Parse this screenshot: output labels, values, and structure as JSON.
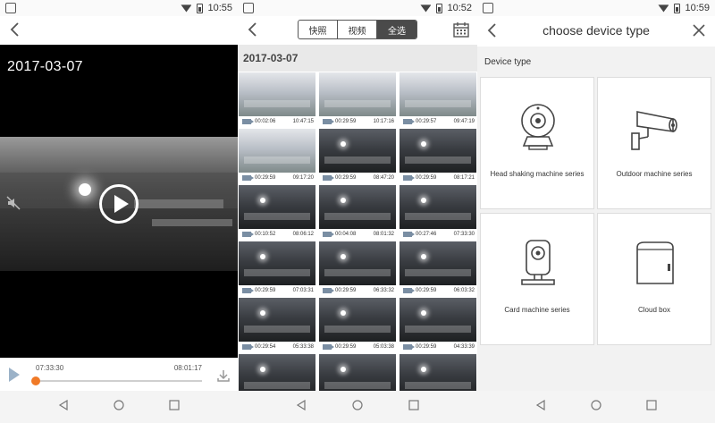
{
  "status_time_1": "10:55",
  "status_time_2": "10:52",
  "status_time_3": "10:59",
  "player": {
    "date_title": "2017-03-07",
    "time_start": "07:33:30",
    "time_end": "08:01:17",
    "progress_fraction": 0.0
  },
  "gallery": {
    "tabs": [
      "快照",
      "视频",
      "全选"
    ],
    "date_label": "2017-03-07",
    "items": [
      {
        "dur": "00:02:06",
        "ts": "10:47:15",
        "tone": "light"
      },
      {
        "dur": "00:29:59",
        "ts": "10:17:16",
        "tone": "light"
      },
      {
        "dur": "00:29:57",
        "ts": "09:47:19",
        "tone": "light"
      },
      {
        "dur": "00:29:59",
        "ts": "09:17:20",
        "tone": "light"
      },
      {
        "dur": "00:29:59",
        "ts": "08:47:20",
        "tone": "dark"
      },
      {
        "dur": "00:29:59",
        "ts": "08:17:21",
        "tone": "dark"
      },
      {
        "dur": "00:10:52",
        "ts": "08:06:12",
        "tone": "dark"
      },
      {
        "dur": "00:04:08",
        "ts": "08:01:32",
        "tone": "dark"
      },
      {
        "dur": "00:27:46",
        "ts": "07:33:30",
        "tone": "dark"
      },
      {
        "dur": "00:29:59",
        "ts": "07:03:31",
        "tone": "dark"
      },
      {
        "dur": "00:29:59",
        "ts": "06:33:32",
        "tone": "dark"
      },
      {
        "dur": "00:29:59",
        "ts": "06:03:32",
        "tone": "dark"
      },
      {
        "dur": "00:29:54",
        "ts": "05:33:38",
        "tone": "dark"
      },
      {
        "dur": "00:29:59",
        "ts": "05:03:38",
        "tone": "dark"
      },
      {
        "dur": "00:29:59",
        "ts": "04:33:39",
        "tone": "dark"
      },
      {
        "dur": "",
        "ts": "",
        "tone": "dark"
      },
      {
        "dur": "",
        "ts": "",
        "tone": "dark"
      },
      {
        "dur": "",
        "ts": "",
        "tone": "dark"
      }
    ]
  },
  "device_type": {
    "title": "choose device type",
    "section": "Device type",
    "cards": [
      {
        "label": "Head shaking machine series",
        "icon": "ptz-camera-icon"
      },
      {
        "label": "Outdoor machine series",
        "icon": "bullet-camera-icon"
      },
      {
        "label": "Card machine series",
        "icon": "card-camera-icon"
      },
      {
        "label": "Cloud box",
        "icon": "cloud-box-icon"
      }
    ]
  }
}
